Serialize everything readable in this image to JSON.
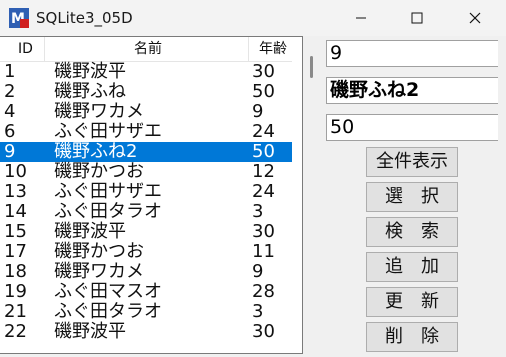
{
  "window": {
    "title": "SQLite3_05D",
    "icon": "app-icon",
    "controls": [
      "minimize-icon",
      "maximize-icon",
      "close-icon"
    ]
  },
  "list": {
    "columns": [
      "ID",
      "名前",
      "年齢"
    ],
    "rows": [
      {
        "id": "1",
        "name": "磯野波平",
        "age": "30"
      },
      {
        "id": "2",
        "name": "磯野ふね",
        "age": "50"
      },
      {
        "id": "4",
        "name": "磯野ワカメ",
        "age": "9"
      },
      {
        "id": "6",
        "name": "ふぐ田サザエ",
        "age": "24"
      },
      {
        "id": "9",
        "name": "磯野ふね2",
        "age": "50"
      },
      {
        "id": "10",
        "name": "磯野かつお",
        "age": "12"
      },
      {
        "id": "13",
        "name": "ふぐ田サザエ",
        "age": "24"
      },
      {
        "id": "14",
        "name": "ふぐ田タラオ",
        "age": "3"
      },
      {
        "id": "15",
        "name": "磯野波平",
        "age": "30"
      },
      {
        "id": "17",
        "name": "磯野かつお",
        "age": "11"
      },
      {
        "id": "18",
        "name": "磯野ワカメ",
        "age": "9"
      },
      {
        "id": "19",
        "name": "ふぐ田マスオ",
        "age": "28"
      },
      {
        "id": "21",
        "name": "ふぐ田タラオ",
        "age": "3"
      },
      {
        "id": "22",
        "name": "磯野波平",
        "age": "30"
      }
    ],
    "selected_id": "9",
    "selection_color": "#0078d7"
  },
  "fields": {
    "id_value": "9",
    "name_value": "磯野ふね2",
    "age_value": "50"
  },
  "buttons": {
    "show_all": "全件表示",
    "select": "選択",
    "search": "検索",
    "add": "追加",
    "update": "更新",
    "delete": "削除"
  }
}
